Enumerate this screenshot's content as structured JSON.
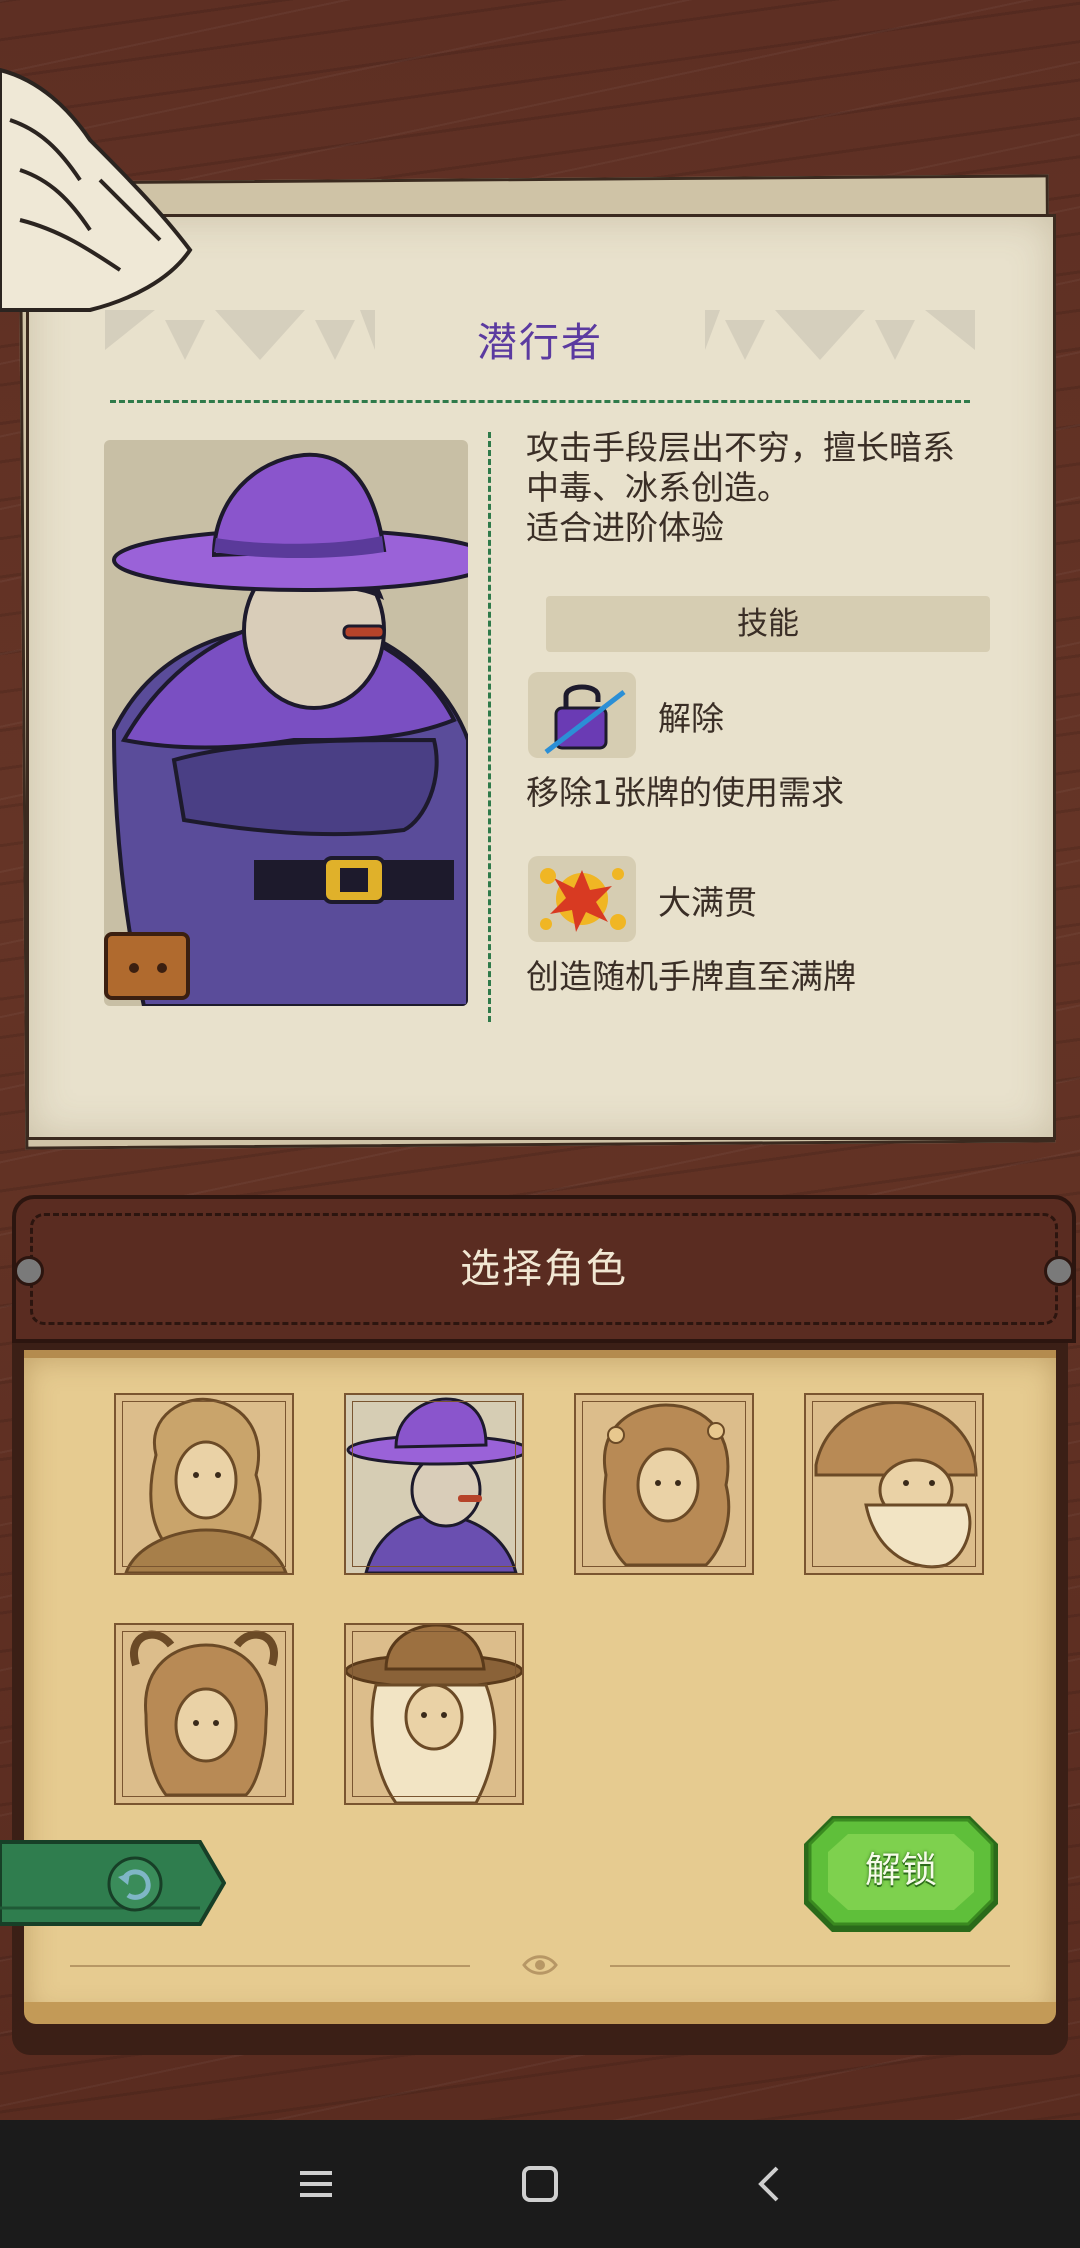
{
  "character": {
    "name": "潜行者",
    "description_lines": [
      "攻击手段层出不穷，擅长暗系",
      "中毒、冰系创造。",
      "适合进阶体验"
    ],
    "skills_heading": "技能",
    "skills": [
      {
        "icon": "unlock-icon",
        "name": "解除",
        "description": "移除1张牌的使用需求"
      },
      {
        "icon": "explosion-icon",
        "name": "大满贯",
        "description": "创造随机手牌直至满牌"
      }
    ]
  },
  "select_panel": {
    "title": "选择角色",
    "characters": [
      {
        "icon": "long-hair-hero-portrait",
        "selected": false
      },
      {
        "icon": "sneaker-portrait",
        "selected": true
      },
      {
        "icon": "flower-girl-portrait",
        "selected": false
      },
      {
        "icon": "bearded-dwarf-portrait",
        "selected": false
      },
      {
        "icon": "horned-girl-portrait",
        "selected": false
      },
      {
        "icon": "witch-portrait",
        "selected": false
      }
    ]
  },
  "buttons": {
    "back_icon": "back-arrow-icon",
    "unlock_label": "解锁"
  },
  "navbar": {
    "icons": [
      "menu-icon",
      "home-icon",
      "back-icon"
    ]
  },
  "colors": {
    "accent_purple": "#5b3aa0",
    "accent_green": "#2f7a4a",
    "unlock_green": "#5fbf3a"
  }
}
